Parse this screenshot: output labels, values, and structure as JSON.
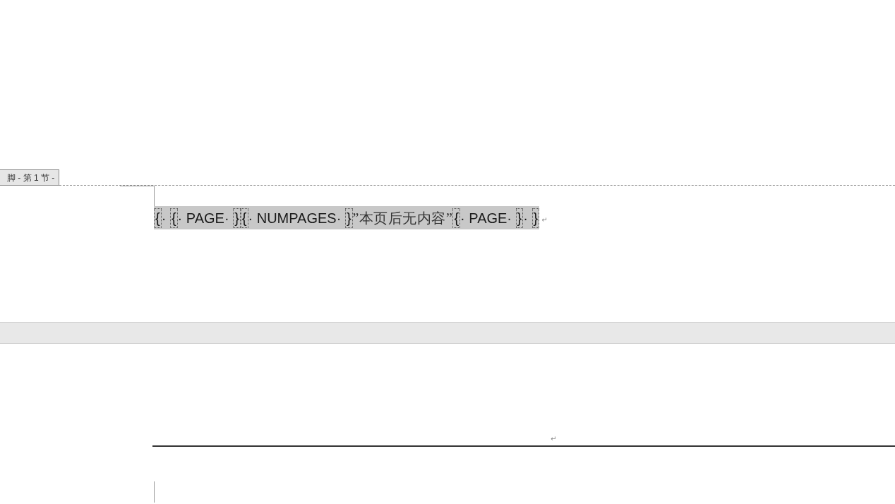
{
  "footer_section_tab": "脚 - 第 1 节 -",
  "footer_field": {
    "segments": [
      {
        "kind": "brace",
        "text": "{"
      },
      {
        "kind": "text",
        "text": "· "
      },
      {
        "kind": "brace",
        "text": "{"
      },
      {
        "kind": "text",
        "text": "· PAGE· "
      },
      {
        "kind": "brace",
        "text": "}"
      },
      {
        "kind": "brace",
        "text": "{"
      },
      {
        "kind": "text",
        "text": "· NUMPAGES· "
      },
      {
        "kind": "brace",
        "text": "}"
      },
      {
        "kind": "cjk",
        "text": "”本页后无内容”"
      },
      {
        "kind": "brace",
        "text": "{"
      },
      {
        "kind": "text",
        "text": "· PAGE· "
      },
      {
        "kind": "brace",
        "text": "}"
      },
      {
        "kind": "text",
        "text": "· "
      },
      {
        "kind": "brace",
        "text": "}"
      }
    ]
  },
  "footer_paragraph_mark": "↵",
  "next_page_header": {
    "paragraph_mark": "↵"
  }
}
